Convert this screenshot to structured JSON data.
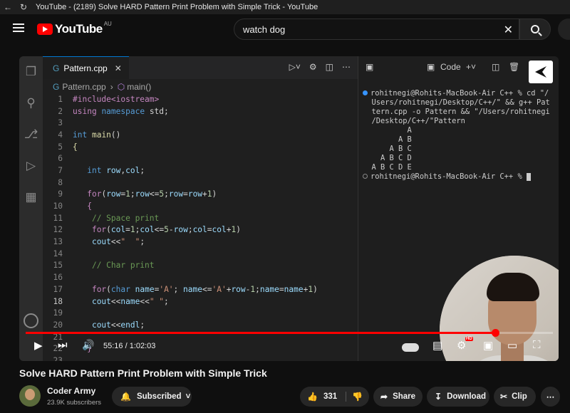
{
  "browser": {
    "tab_title": "YouTube - (2189) Solve HARD Pattern Print Problem with Simple Trick - YouTube"
  },
  "header": {
    "logo_text": "YouTube",
    "region": "AU",
    "search_value": "watch dog"
  },
  "editor": {
    "tab_label": "Pattern.cpp",
    "breadcrumb_file": "Pattern.cpp",
    "breadcrumb_symbol": "main()",
    "current_line": 18
  },
  "code_lines": [
    {
      "n": "1",
      "html": "<span class='inc'>#include&lt;iostream&gt;</span>"
    },
    {
      "n": "2",
      "html": "<span class='ctl'>using</span> <span class='kw'>namespace</span> <span class='src'>std;</span>"
    },
    {
      "n": "3",
      "html": ""
    },
    {
      "n": "4",
      "html": "<span class='kw'>int</span> <span class='fn'>main</span><span class='src'>()</span>"
    },
    {
      "n": "5",
      "html": "<span class='fn'>{</span>"
    },
    {
      "n": "6",
      "html": ""
    },
    {
      "n": "7",
      "html": "   <span class='kw'>int</span> <span class='var'>row</span><span class='src'>,</span><span class='var'>col</span><span class='src'>;</span>"
    },
    {
      "n": "8",
      "html": ""
    },
    {
      "n": "9",
      "html": "   <span class='ctl'>for</span><span class='src'>(</span><span class='var'>row</span><span class='src'>=</span><span class='num'>1</span><span class='src'>;</span><span class='var'>row</span><span class='src'>&lt;=</span><span class='num'>5</span><span class='src'>;</span><span class='var'>row</span><span class='src'>=</span><span class='var'>row</span><span class='src'>+</span><span class='num'>1</span><span class='src'>)</span>"
    },
    {
      "n": "10",
      "html": "   <span class='ctl'>{</span>"
    },
    {
      "n": "11",
      "html": "    <span class='cmt'>// Space print</span>"
    },
    {
      "n": "12",
      "html": "    <span class='ctl'>for</span><span class='src'>(</span><span class='var'>col</span><span class='src'>=</span><span class='num'>1</span><span class='src'>;</span><span class='var'>col</span><span class='src'>&lt;=</span><span class='num'>5</span><span class='src'>-</span><span class='var'>row</span><span class='src'>;</span><span class='var'>col</span><span class='src'>=</span><span class='var'>col</span><span class='src'>+</span><span class='num'>1</span><span class='src'>)</span>"
    },
    {
      "n": "13",
      "html": "    <span class='var'>cout</span><span class='src'>&lt;&lt;</span><span class='str'>\"  \"</span><span class='src'>;</span>"
    },
    {
      "n": "14",
      "html": ""
    },
    {
      "n": "15",
      "html": "    <span class='cmt'>// Char print</span>"
    },
    {
      "n": "16",
      "html": ""
    },
    {
      "n": "17",
      "html": "    <span class='ctl'>for</span><span class='src'>(</span><span class='kw'>char</span> <span class='var'>name</span><span class='src'>=</span><span class='str'>'A'</span><span class='src'>; </span><span class='var'>name</span><span class='src'>&lt;=</span><span class='str'>'A'</span><span class='src'>+</span><span class='var'>row</span><span class='src'>-</span><span class='num'>1</span><span class='src'>;</span><span class='var'>name</span><span class='src'>=</span><span class='var'>name</span><span class='src'>+</span><span class='num'>1</span><span class='src'>)</span>"
    },
    {
      "n": "18",
      "html": "    <span class='var'>cout</span><span class='src'>&lt;&lt;</span><span class='var'>name</span><span class='src'>&lt;&lt;</span><span class='str'>\" \"</span><span class='src'>;</span>"
    },
    {
      "n": "19",
      "html": ""
    },
    {
      "n": "20",
      "html": "    <span class='var'>cout</span><span class='src'>&lt;&lt;</span><span class='var'>endl</span><span class='src'>;</span>"
    },
    {
      "n": "21",
      "html": ""
    },
    {
      "n": "22",
      "html": "   <span class='ctl'>}</span>"
    },
    {
      "n": "23",
      "html": ""
    }
  ],
  "terminal": {
    "header_label": "Code",
    "lines": [
      "rohitnegi@Rohits-MacBook-Air C++ % cd \"/",
      "Users/rohitnegi/Desktop/C++/\" && g++ Pat",
      "tern.cpp -o Pattern && \"/Users/rohitnegi",
      "/Desktop/C++/\"Pattern",
      "        A",
      "      A B",
      "    A B C",
      "  A B C D",
      "A B C D E"
    ],
    "prompt": "rohitnegi@Rohits-MacBook-Air C++ % "
  },
  "player": {
    "time_display": "55:16 / 1:02:03",
    "progress_fraction": 0.891,
    "hd_label": "HD"
  },
  "video": {
    "title": "Solve HARD Pattern Print Problem with Simple Trick",
    "channel_name": "Coder Army",
    "subscribers": "23.9K subscribers",
    "subscribed_label": "Subscribed",
    "likes": "331",
    "share_label": "Share",
    "download_label": "Download",
    "clip_label": "Clip"
  },
  "icons": {
    "back": "arrow-left",
    "reload": "refresh",
    "menu": "hamburger",
    "search": "magnifier",
    "clear": "x"
  },
  "colors": {
    "brand_red": "#ff0000",
    "vscode_blue": "#0078d4"
  }
}
